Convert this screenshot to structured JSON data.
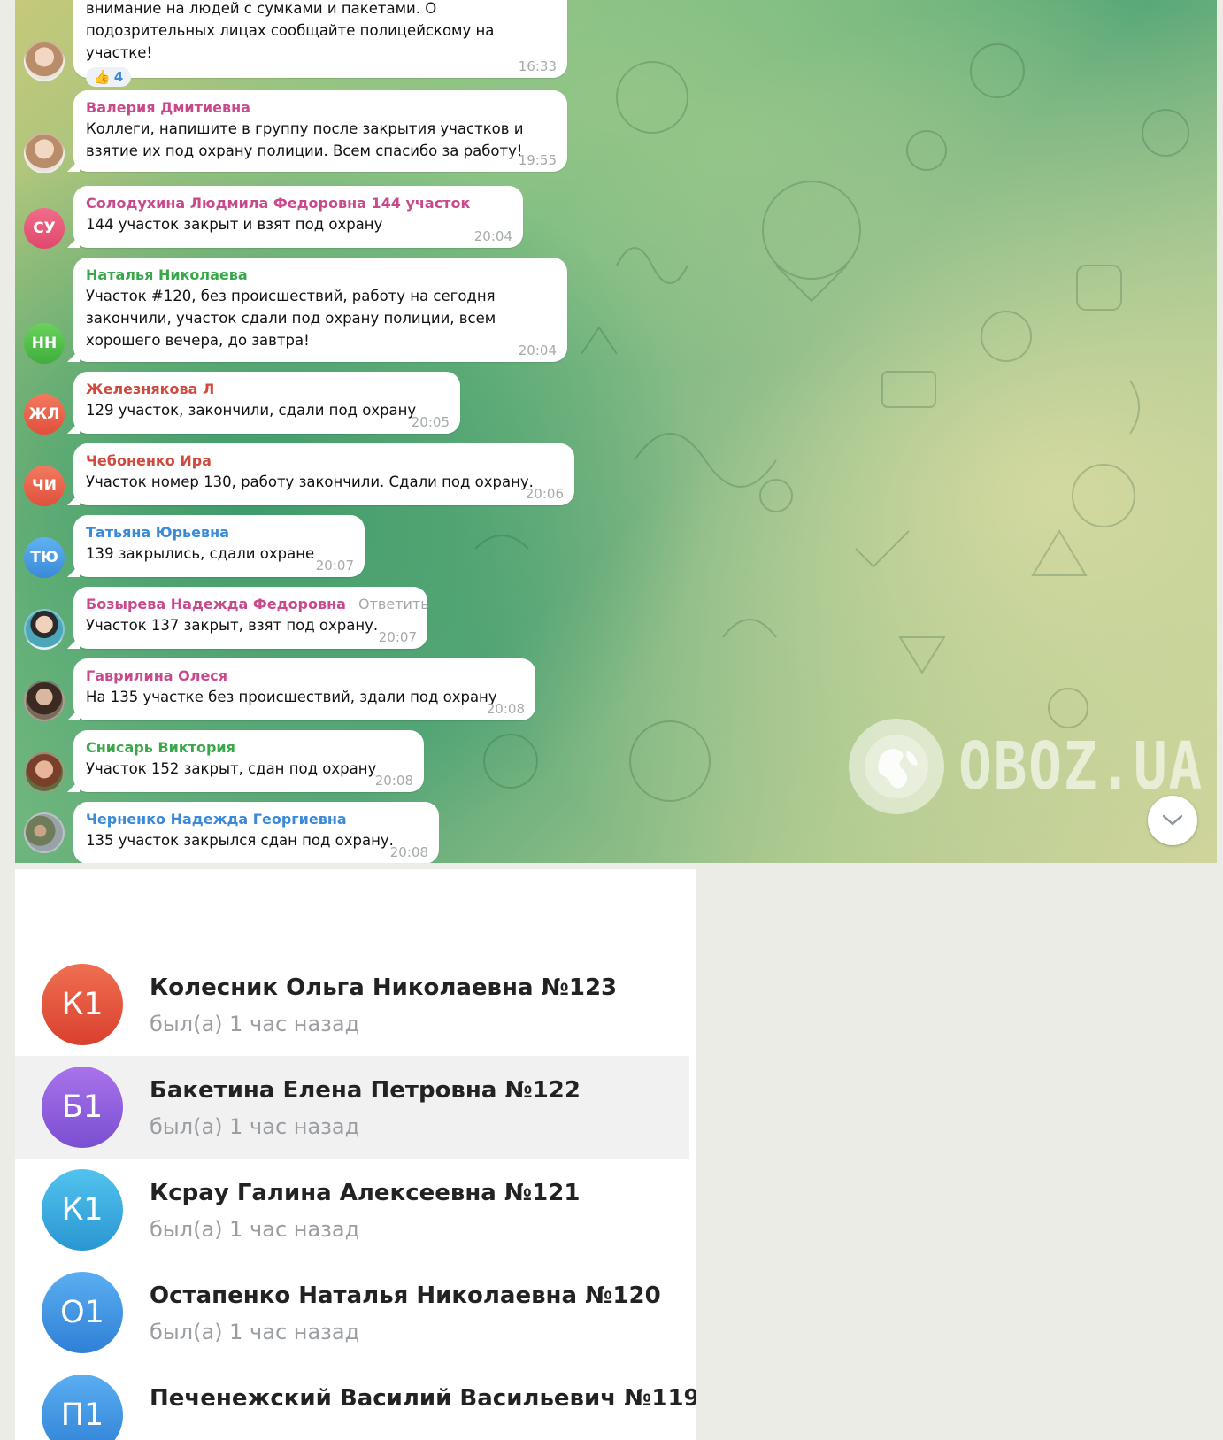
{
  "chat": {
    "first_message": {
      "text": "внимание на людей с сумками и пакетами. О подозрительных лицах сообщайте полицейскому на участке!",
      "reaction_emoji": "👍",
      "reaction_count": "4",
      "time": "16:33"
    },
    "messages": [
      {
        "sender": "Валерия Дмитиевна",
        "text": "Коллеги, напишите в группу после закрытия участков и взятие их под охрану полиции. Всем спасибо за работу!",
        "time": "19:55"
      },
      {
        "sender": "Солодухина Людмила Федоровна 144 участок",
        "avatar": "СУ",
        "text": "144 участок закрыт и взят под охрану",
        "time": "20:04"
      },
      {
        "sender": "Наталья Николаева",
        "avatar": "НН",
        "text": "Участок #120, без происшествий, работу на сегодня закончили, участок сдали под охрану полиции, всем хорошего вечера, до завтра!",
        "time": "20:04"
      },
      {
        "sender": "Железнякова Л",
        "avatar": "ЖЛ",
        "text": "129 участок, закончили, сдали под охрану",
        "time": "20:05"
      },
      {
        "sender": "Чебоненко Ира",
        "avatar": "ЧИ",
        "text": "Участок номер 130, работу закончили. Сдали под охрану.",
        "time": "20:06"
      },
      {
        "sender": "Татьяна Юрьевна",
        "avatar": "ТЮ",
        "text": "139 закрылись, сдали охране",
        "time": "20:07"
      },
      {
        "sender": "Бозырева Надежда Федоровна",
        "reply_label": "Ответить",
        "text": "Участок 137 закрыт, взят под охрану.",
        "time": "20:07"
      },
      {
        "sender": "Гаврилина Олеся",
        "text": "На 135 участке без происшествий, здали под охрану",
        "time": "20:08"
      },
      {
        "sender": "Снисарь Виктория",
        "text": "Участок 152 закрыт, сдан под охрану",
        "time": "20:08"
      },
      {
        "sender": "Черненко Надежда Георгиевна",
        "text": "135 участок закрылся сдан под охрану.",
        "time": "20:08"
      }
    ],
    "watermark": "OBOZ.UA",
    "colors": {
      "valeria": "#c94a8c",
      "solodukhina": "#c94a8c",
      "natalia": "#3aa84a",
      "zheleznyakova": "#d04a3e",
      "chebonenko": "#d04a3e",
      "tatiana": "#3a8ad8",
      "bozyreva": "#c94a8c",
      "gavrilina": "#c94a8c",
      "snisar": "#3aa84a",
      "chernenko": "#3a8ad8"
    }
  },
  "members": [
    {
      "initials": "К1",
      "name": "Колесник Ольга Николаевна №123",
      "status": "был(а) 1 час назад",
      "color": "#e0503c"
    },
    {
      "initials": "Б1",
      "name": "Бакетина Елена Петровна №122",
      "status": "был(а) 1 час назад",
      "color": "#8f5ad8"
    },
    {
      "initials": "К1",
      "name": "Ксрау Галина Алексеевна №121",
      "status": "был(а) 1 час назад",
      "color": "#35a6dc"
    },
    {
      "initials": "О1",
      "name": "Остапенко Наталья Николаевна №120",
      "status": "был(а) 1 час назад",
      "color": "#3a8fdc"
    },
    {
      "initials": "П1",
      "name": "Печенежский Василий Васильевич №119",
      "status": "",
      "color": "#3a8fdc"
    }
  ]
}
